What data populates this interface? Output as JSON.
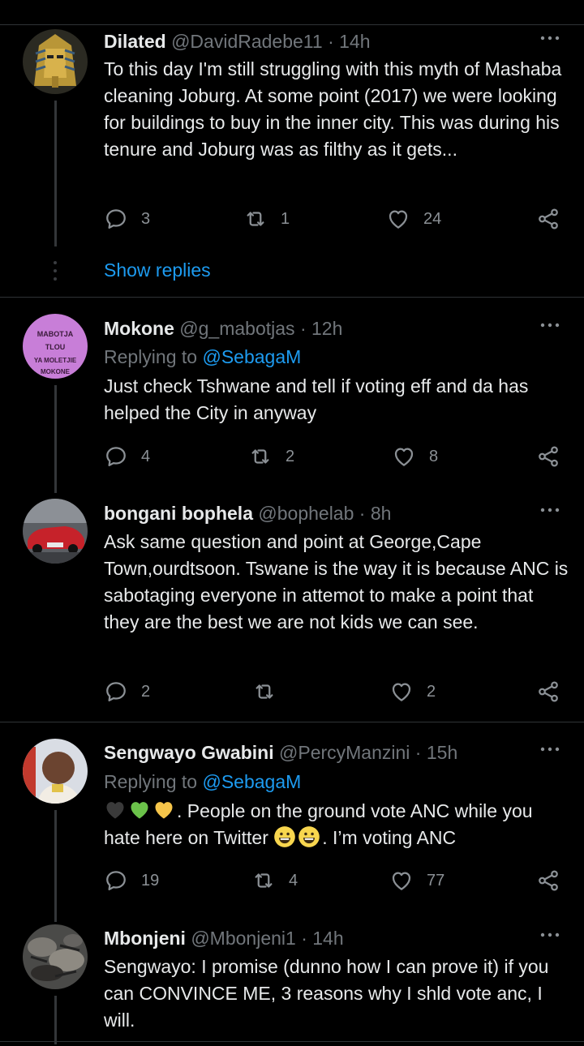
{
  "tweets": [
    {
      "name": "Dilated",
      "handle": "@DavidRadebe11",
      "time": "14h",
      "text": "To this day I'm still struggling with this myth of Mashaba cleaning Joburg. At some point (2017) we were looking for buildings to buy in the inner city. This was during his tenure and Joburg was as filthy as it gets...",
      "replies": "3",
      "retweets": "1",
      "likes": "24",
      "show_replies": "Show replies"
    },
    {
      "name": "Mokone",
      "handle": "@g_mabotjas",
      "time": "12h",
      "replying_label": "Replying to",
      "replying_to": "@SebagaM",
      "text": "Just check Tshwane and tell if voting eff and da has helped the City in anyway",
      "replies": "4",
      "retweets": "2",
      "likes": "8",
      "avatar_text": [
        "MABOTJA",
        "TLOU",
        "YA MOLETJIE",
        "MOKONE"
      ]
    },
    {
      "name": "bongani bophela",
      "handle": "@bophelab",
      "time": "8h",
      "text": "Ask same question and point at George,Cape Town,ourdtsoon. Tswane is the way it is because ANC is sabotaging everyone in attemot to make a point that they are the best we are not kids we can see.",
      "replies": "2",
      "retweets": "",
      "likes": "2"
    },
    {
      "name": "Sengwayo Gwabini",
      "handle": "@PercyManzini",
      "time": "15h",
      "replying_label": "Replying to",
      "replying_to": "@SebagaM",
      "text_part1": ". People on the ground vote ANC while you hate here on Twitter ",
      "text_part2": ". I’m voting ANC",
      "replies": "19",
      "retweets": "4",
      "likes": "77"
    },
    {
      "name": "Mbonjeni",
      "handle": "@Mbonjeni1",
      "time": "14h",
      "text": "Sengwayo: I promise (dunno how I can prove it) if you can CONVINCE ME, 3 reasons why I shld vote anc, I will."
    }
  ],
  "separator": "·",
  "colors": {
    "background": "#000000",
    "link": "#1d9bf0",
    "muted": "#71767b",
    "text": "#e7e9ea"
  },
  "icons": [
    "more-icon",
    "reply-icon",
    "retweet-icon",
    "like-icon",
    "share-icon"
  ]
}
